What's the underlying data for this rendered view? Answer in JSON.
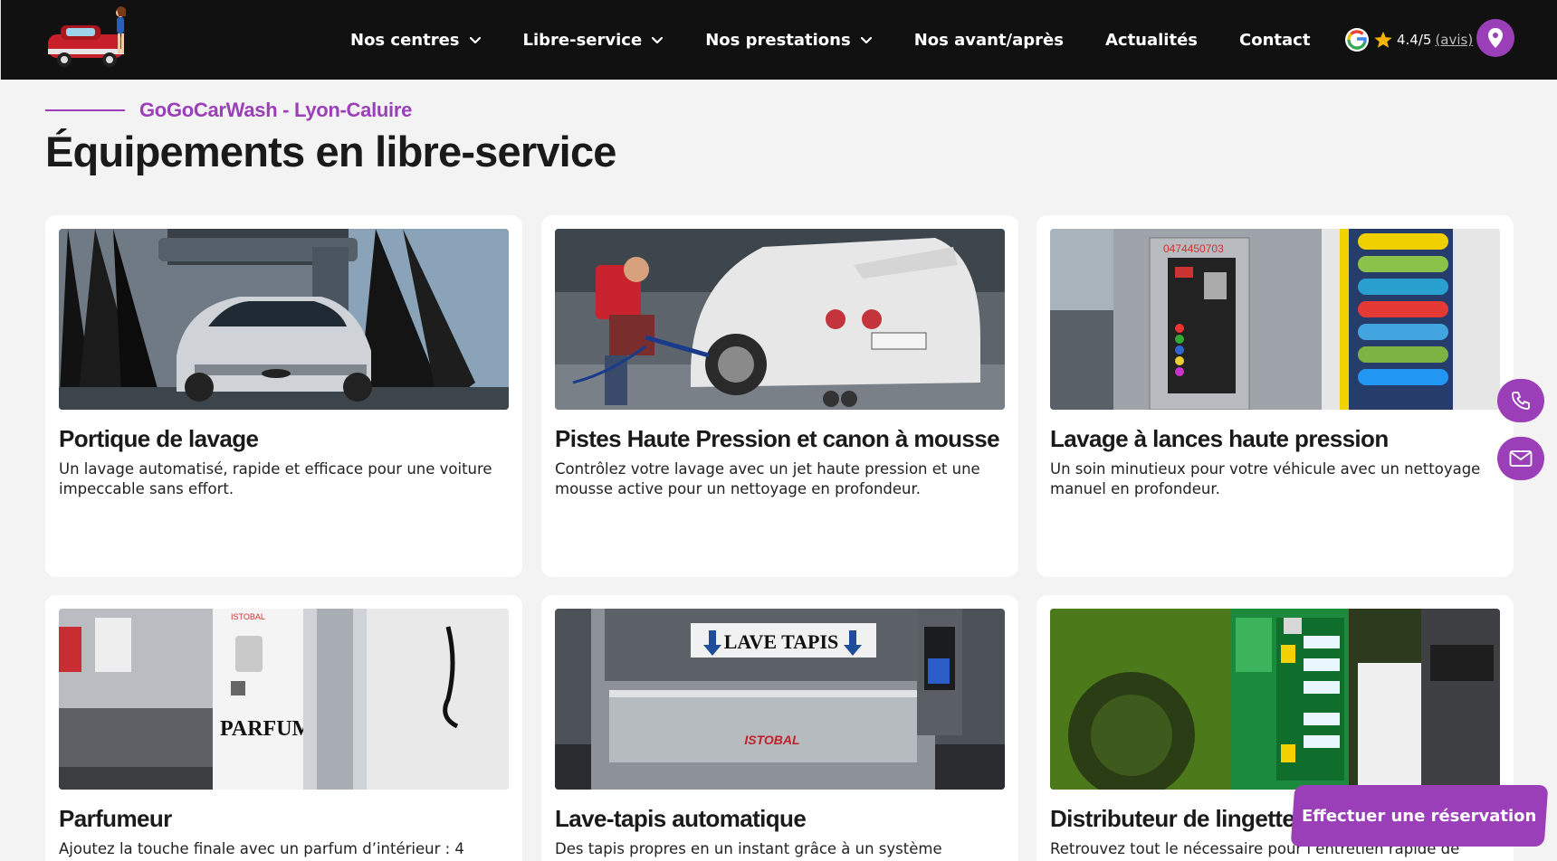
{
  "header": {
    "nav": [
      {
        "label": "Nos centres",
        "dropdown": true
      },
      {
        "label": "Libre-service",
        "dropdown": true
      },
      {
        "label": "Nos prestations",
        "dropdown": true
      },
      {
        "label": "Nos avant/après",
        "dropdown": false
      },
      {
        "label": "Actualités",
        "dropdown": false
      },
      {
        "label": "Contact",
        "dropdown": false
      }
    ],
    "rating": {
      "score": "4.4/5",
      "link": "(avis)"
    },
    "icons": [
      "google-icon",
      "star-icon",
      "location-pin-icon"
    ]
  },
  "section": {
    "eyebrow": "GoGoCarWash - Lyon-Caluire",
    "title": "Équipements en libre-service"
  },
  "cards": [
    {
      "title": "Portique de lavage",
      "description": "Un lavage automatisé, rapide et efficace pour une voiture impeccable sans effort."
    },
    {
      "title": "Pistes Haute Pression et canon à mousse",
      "description": "Contrôlez votre lavage avec un jet haute pression et une mousse active pour un nettoyage en profondeur."
    },
    {
      "title": "Lavage à lances haute pression",
      "description": "Un soin minutieux pour votre véhicule avec un nettoyage manuel en profondeur."
    },
    {
      "title": "Parfumeur",
      "description": "Ajoutez la touche finale avec un parfum d’intérieur : 4"
    },
    {
      "title": "Lave-tapis automatique",
      "description": "Des tapis propres en un instant grâce à un système"
    },
    {
      "title": "Distributeur de lingettes et",
      "description": "Retrouvez tout le nécessaire pour l’entretien rapide de"
    }
  ],
  "image_text": {
    "lave_tapis": "LAVE TAPIS",
    "istobal": "ISTOBAL",
    "parfum": "PARFUM",
    "phone_number": "0474450703"
  },
  "floating": {
    "reserve_label": "Effectuer une réservation",
    "icons": [
      "phone-icon",
      "mail-icon"
    ]
  },
  "colors": {
    "accent": "#9a3fb8",
    "header_bg": "#111111",
    "page_bg": "#f3f3f3"
  }
}
